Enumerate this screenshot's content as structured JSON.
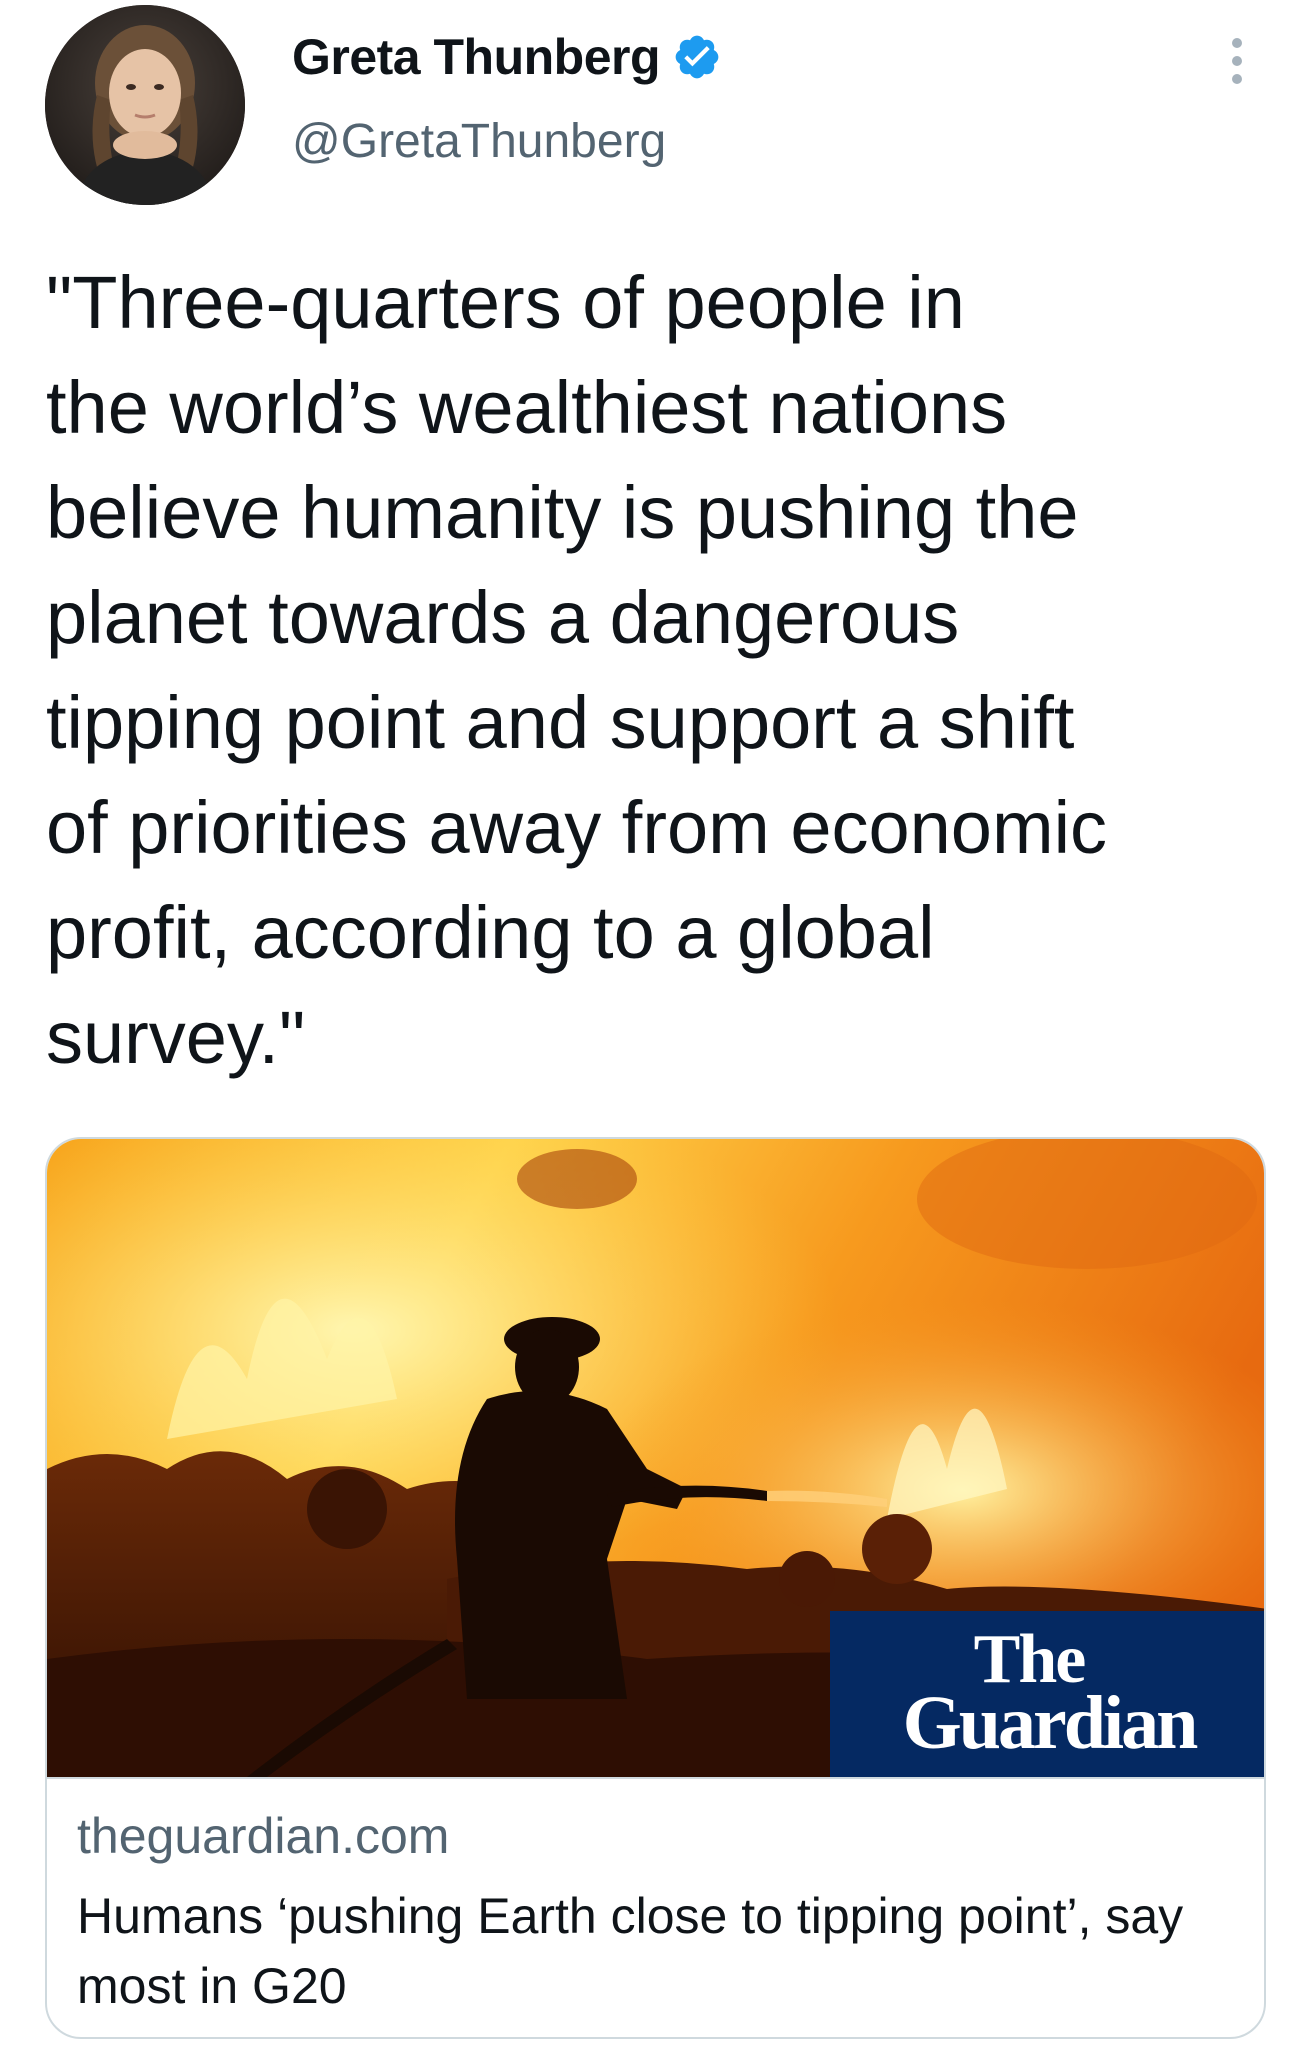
{
  "author": {
    "display_name": "Greta Thunberg",
    "handle": "@GretaThunberg",
    "verified": true,
    "verified_badge_color": "#1d9bf0"
  },
  "tweet": {
    "text": "\"Three-quarters of people in\nthe world’s wealthiest nations\nbelieve humanity is pushing the\nplanet towards a dangerous\ntipping point and support a shift\nof priorities away from economic\nprofit, according to a global\nsurvey.\""
  },
  "link_card": {
    "image_icon": "wildfire-firefighter-photo",
    "logo_the": "The",
    "logo_name": "Guardian",
    "logo_color": "#052962",
    "domain": "theguardian.com",
    "title": "Humans ‘pushing Earth close to tipping point’, say most in G20"
  },
  "icons": {
    "avatar": "avatar-photo",
    "verified": "verified-badge-icon",
    "more": "more-options-icon"
  }
}
